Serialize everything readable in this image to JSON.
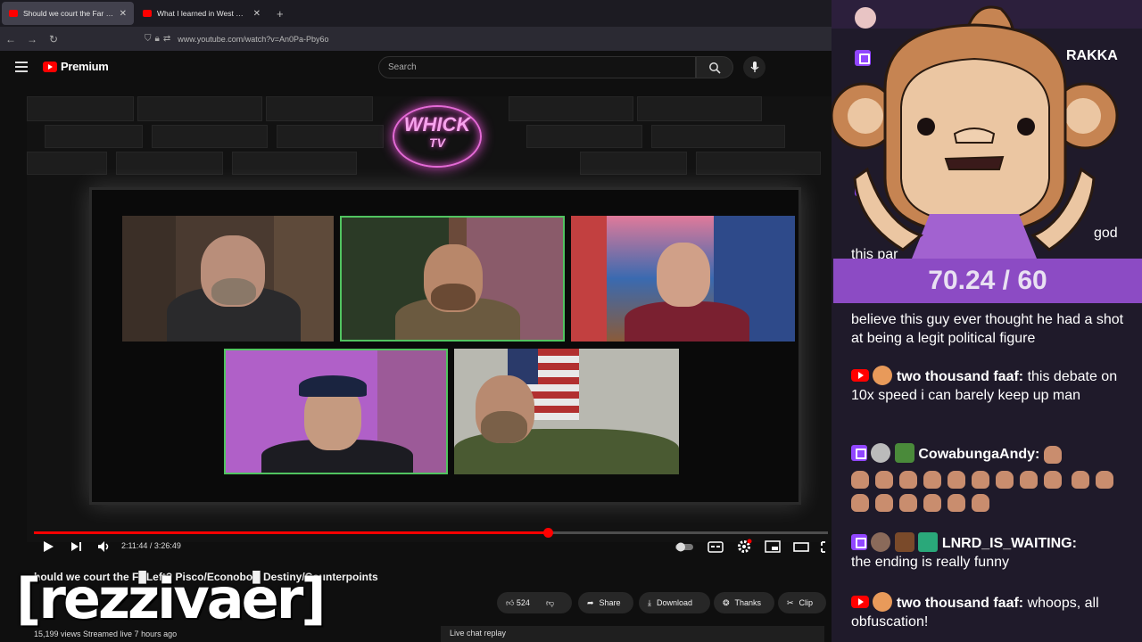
{
  "browser": {
    "tabs": [
      {
        "label": "Should we court the Far Left? P",
        "active": true
      },
      {
        "label": "What I learned in West Virginia",
        "active": false
      }
    ],
    "new_tab": "+",
    "url": "www.youtube.com/watch?v=An0Pa-Pby6o"
  },
  "youtube": {
    "logo_text": "Premium",
    "search_placeholder": "Search"
  },
  "video": {
    "channel_logo_line1": "WHICK",
    "channel_logo_line2": "TV",
    "current_time": "2:11:44",
    "duration": "3:26:49",
    "progress_fraction": 0.6473
  },
  "watch": {
    "title": "hould we court the F█Left? Pisco/Econobo█ Destiny/Counterpoints",
    "like_count": "524",
    "share": "Share",
    "download": "Download",
    "thanks": "Thanks",
    "clip": "Clip",
    "meta": "15,199 views  Streamed live 7 hours ago",
    "live_chat_replay": "Live chat replay",
    "watermark": "[rezzivaer]"
  },
  "chat": {
    "rakka": "RAKKA",
    "god": "god",
    "this_par": "this par",
    "score": "70.24 / 60",
    "msg1_text": "believe this guy ever thought he had a shot at being a legit political figure",
    "msg2_user": "two thousand faaf:",
    "msg2_text": "this debate on 10x speed i can barely keep up man",
    "msg3_user": "CowabungaAndy:",
    "msg4_user": "LNRD_IS_WAITING:",
    "msg4_text": "the ending is really funny",
    "msg5_user": "two thousand faaf:",
    "msg5_text": "whoops, all obfuscation!"
  }
}
